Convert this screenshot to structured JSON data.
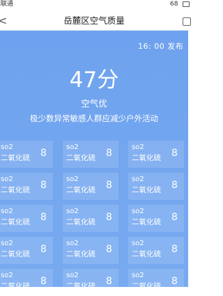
{
  "status_bar": {
    "carrier": "国联通",
    "battery": "68"
  },
  "nav": {
    "back": "<",
    "title": "岳麓区空气质量"
  },
  "aqi": {
    "update_time": "16: 00 发布",
    "score": "47分",
    "level": "空气优",
    "advice": "极少数异常敏感人群应减少户外活动"
  },
  "pollutants": [
    {
      "code": "so2",
      "name": "二氧化硫",
      "value": "8"
    },
    {
      "code": "so2",
      "name": "二氧化硫",
      "value": "8"
    },
    {
      "code": "so2",
      "name": "二氧化硫",
      "value": "8"
    },
    {
      "code": "so2",
      "name": "二氧化硫",
      "value": "8"
    },
    {
      "code": "so2",
      "name": "二氧化硫",
      "value": "8"
    },
    {
      "code": "so2",
      "name": "二氧化硫",
      "value": "8"
    },
    {
      "code": "so2",
      "name": "二氧化硫",
      "value": "8"
    },
    {
      "code": "so2",
      "name": "二氧化硫",
      "value": "8"
    },
    {
      "code": "so2",
      "name": "二氧化硫",
      "value": "8"
    },
    {
      "code": "so2",
      "name": "二氧化硫",
      "value": "8"
    },
    {
      "code": "so2",
      "name": "二氧化硫",
      "value": "8"
    },
    {
      "code": "so2",
      "name": "二氧化硫",
      "value": "8"
    },
    {
      "code": "so2",
      "name": "二氧化硫",
      "value": "8"
    },
    {
      "code": "so2",
      "name": "二氧化硫",
      "value": "8"
    },
    {
      "code": "so2",
      "name": "二氧化硫",
      "value": "8"
    }
  ],
  "colors": {
    "background": "#6fa3ee",
    "text": "#ffffff"
  },
  "icons": {
    "back": "chevron-left-icon",
    "more": "square-icon",
    "battery": "battery-icon"
  }
}
